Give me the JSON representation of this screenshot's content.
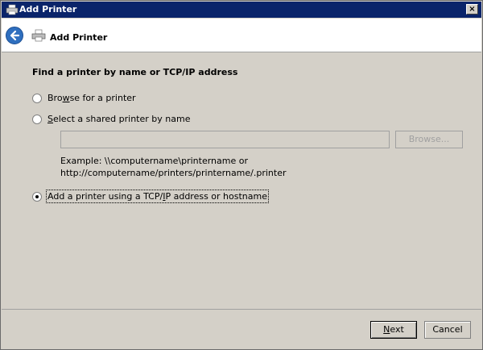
{
  "window": {
    "title": "Add Printer",
    "close_label": "×"
  },
  "header": {
    "title": "Add Printer"
  },
  "content": {
    "heading": "Find a printer by name or TCP/IP address",
    "options": [
      {
        "pre": "Bro",
        "accel": "w",
        "post": "se for a printer",
        "checked": false
      },
      {
        "pre": "",
        "accel": "S",
        "post": "elect a shared printer by name",
        "checked": false
      },
      {
        "pre": "Add a printer using a TCP/",
        "accel": "I",
        "post": "P address or hostname",
        "checked": true
      }
    ],
    "printer_name_value": "",
    "browse_label": "Browse...",
    "example_line1": "Example: \\\\computername\\printername or",
    "example_line2": "http://computername/printers/printername/.printer"
  },
  "footer": {
    "next": {
      "accel": "N",
      "post": "ext"
    },
    "cancel_label": "Cancel"
  },
  "colors": {
    "titlebar": "#0a246a",
    "face": "#d4d0c8",
    "back_button": "#2f6fbf"
  }
}
